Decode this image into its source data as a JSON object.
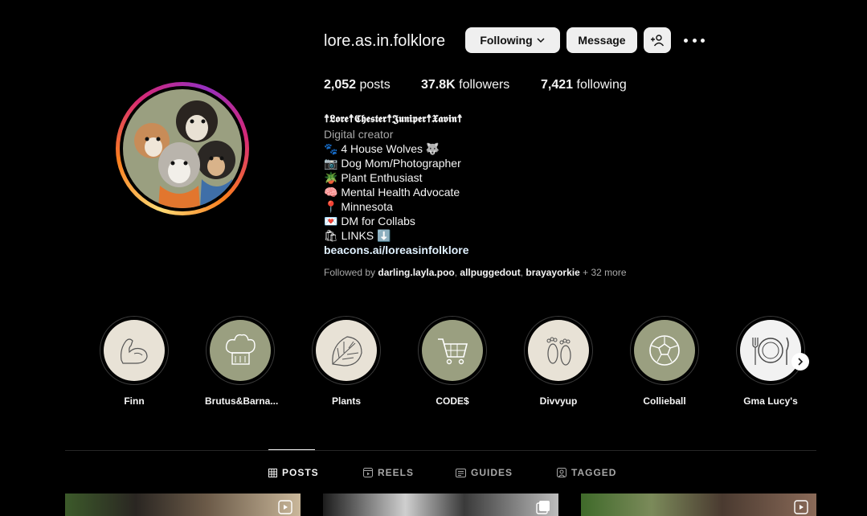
{
  "profile": {
    "username": "lore.as.in.folklore",
    "following_button": "Following",
    "message_button": "Message"
  },
  "stats": {
    "posts_count": "2,052",
    "posts_label": "posts",
    "followers_count": "37.8K",
    "followers_label": "followers",
    "following_count": "7,421",
    "following_label": "following"
  },
  "bio": {
    "name": "☨𝕷𝖔𝖗𝖊☨𝕮𝖍𝖊𝖘𝖙𝖊𝖗☨𝕵𝖚𝖓𝖎𝖕𝖊𝖗☨𝖃𝖆𝖛𝖎𝖓☨",
    "category": "Digital creator",
    "lines": [
      "🐾 4 House Wolves 🐺",
      "📷 Dog Mom/Photographer",
      "🪴 Plant Enthusiast",
      "🧠 Mental Health Advocate",
      "📍 Minnesota",
      "💌 DM for Collabs",
      "🛍 LINKS ⬇️"
    ],
    "link": "beacons.ai/loreasinfolklore"
  },
  "followed_by": {
    "prefix": "Followed by",
    "users": [
      "darling.layla.poo",
      "allpuggedout",
      "brayayorkie"
    ],
    "suffix": "+ 32 more"
  },
  "highlights": [
    {
      "label": "Finn",
      "icon": "flexed-arm-icon",
      "bg": "#e8e2d6"
    },
    {
      "label": "Brutus&Barna...",
      "icon": "chef-hat-icon",
      "bg": "#9a9f80"
    },
    {
      "label": "Plants",
      "icon": "monstera-leaf-icon",
      "bg": "#e8e2d6"
    },
    {
      "label": "CODE$",
      "icon": "shopping-cart-icon",
      "bg": "#9a9f80"
    },
    {
      "label": "Divvyup",
      "icon": "footprints-icon",
      "bg": "#e8e2d6"
    },
    {
      "label": "Collieball",
      "icon": "soccer-ball-icon",
      "bg": "#9a9f80"
    },
    {
      "label": "Gma Lucy's",
      "icon": "plate-cutlery-icon",
      "bg": "#f2f2f2"
    }
  ],
  "tabs": [
    {
      "label": "POSTS",
      "icon": "grid-icon",
      "active": true
    },
    {
      "label": "REELS",
      "icon": "reels-icon",
      "active": false
    },
    {
      "label": "GUIDES",
      "icon": "guides-icon",
      "active": false
    },
    {
      "label": "TAGGED",
      "icon": "tagged-icon",
      "active": false
    }
  ],
  "colors": {
    "background": "#000000",
    "text": "#f5f5f5",
    "secondary_text": "#a8a8a8",
    "button_bg": "#efefef",
    "link": "#e0f1ff",
    "sage": "#9a9f80",
    "cream": "#e8e2d6"
  }
}
